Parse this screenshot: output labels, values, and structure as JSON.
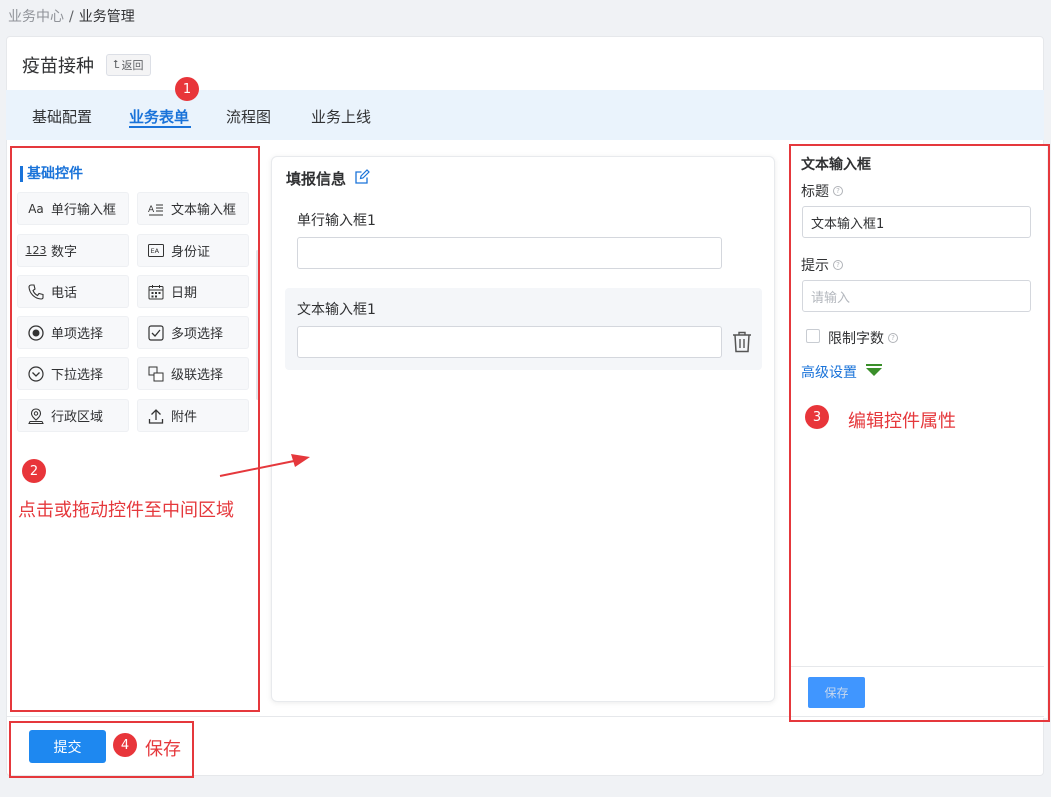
{
  "breadcrumb": {
    "parent": "业务中心",
    "separator": "/",
    "current": "业务管理"
  },
  "header": {
    "title": "疫苗接种",
    "back_label": "返回"
  },
  "tabs": [
    {
      "label": "基础配置",
      "active": false
    },
    {
      "label": "业务表单",
      "active": true
    },
    {
      "label": "流程图",
      "active": false
    },
    {
      "label": "业务上线",
      "active": false
    }
  ],
  "left_panel": {
    "section_title": "基础控件",
    "controls": [
      {
        "label": "单行输入框",
        "icon": "text-aa-icon"
      },
      {
        "label": "文本输入框",
        "icon": "textarea-icon"
      },
      {
        "label": "数字",
        "icon": "number-icon"
      },
      {
        "label": "身份证",
        "icon": "id-card-icon"
      },
      {
        "label": "电话",
        "icon": "phone-icon"
      },
      {
        "label": "日期",
        "icon": "calendar-icon"
      },
      {
        "label": "单项选择",
        "icon": "radio-icon"
      },
      {
        "label": "多项选择",
        "icon": "checkbox-icon"
      },
      {
        "label": "下拉选择",
        "icon": "dropdown-icon"
      },
      {
        "label": "级联选择",
        "icon": "cascade-icon"
      },
      {
        "label": "行政区域",
        "icon": "location-icon"
      },
      {
        "label": "附件",
        "icon": "upload-icon"
      }
    ]
  },
  "form": {
    "title": "填报信息",
    "fields": [
      {
        "label": "单行输入框1",
        "value": ""
      },
      {
        "label": "文本输入框1",
        "value": ""
      }
    ]
  },
  "props": {
    "title": "文本输入框",
    "label_title": "标题",
    "title_value": "文本输入框1",
    "label_hint": "提示",
    "hint_placeholder": "请输入",
    "limit_label": "限制字数",
    "advanced": "高级设置",
    "save": "保存"
  },
  "footer": {
    "submit": "提交"
  },
  "annotations": {
    "n1": "1",
    "n2": "2",
    "n3": "3",
    "n4": "4",
    "drag_hint": "点击或拖动控件至中间区域",
    "edit_hint": "编辑控件属性",
    "save_hint": "保存"
  },
  "colors": {
    "accent": "#1a73d9",
    "annotation": "#e5383c",
    "submit": "#1e88f0",
    "advanced_caret": "#3a8f2a"
  }
}
